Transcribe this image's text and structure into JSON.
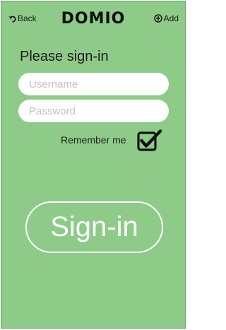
{
  "header": {
    "back_label": "Back",
    "brand": "DOMIO",
    "add_label": "Add"
  },
  "login": {
    "heading": "Please sign-in",
    "username_placeholder": "Username",
    "username_value": "",
    "password_placeholder": "Password",
    "password_value": "",
    "remember_label": "Remember me",
    "remember_checked": true,
    "signin_label": "Sign-in"
  },
  "colors": {
    "background": "#8ecb88",
    "field_background": "#ffffff",
    "button_outline": "#ffffff",
    "text": "#1c1c1c"
  },
  "icons": {
    "back": "back-arrow-icon",
    "add": "plus-circle-icon",
    "remember": "checkbox-checked-icon"
  }
}
